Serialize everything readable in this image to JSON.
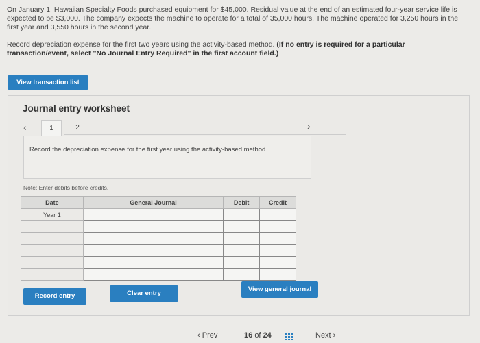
{
  "problem": {
    "paragraph1": "On January 1, Hawaiian Specialty Foods purchased equipment for $45,000. Residual value at the end of an estimated four-year service life is expected to be $3,000. The company expects the machine to operate for a total of 35,000 hours. The machine operated for 3,250 hours in the first year and 3,550 hours in the second year.",
    "paragraph2": "Record depreciation expense for the first two years using the activity-based method. ",
    "paragraph2_bold": "(If no entry is required for a particular transaction/event, select \"No Journal Entry Required\" in the first account field.)"
  },
  "view_transaction_list_label": "View transaction list",
  "worksheet": {
    "title": "Journal entry worksheet",
    "tabs": [
      "1",
      "2"
    ],
    "instruction": "Record the depreciation expense for the first year using the activity-based method.",
    "note": "Note: Enter debits before credits.",
    "columns": {
      "date": "Date",
      "account": "General Journal",
      "debit": "Debit",
      "credit": "Credit"
    },
    "rows": [
      {
        "date": "Year 1"
      },
      {
        "date": ""
      },
      {
        "date": ""
      },
      {
        "date": ""
      },
      {
        "date": ""
      },
      {
        "date": ""
      }
    ]
  },
  "buttons": {
    "record_entry": "Record entry",
    "clear_entry": "Clear entry",
    "view_general_journal": "View general journal"
  },
  "footer": {
    "prev": "Prev",
    "current_page": "16",
    "of": "of",
    "total_pages": "24",
    "next": "Next"
  },
  "colors": {
    "accent": "#2a7fc0",
    "background": "#ecebe8"
  }
}
